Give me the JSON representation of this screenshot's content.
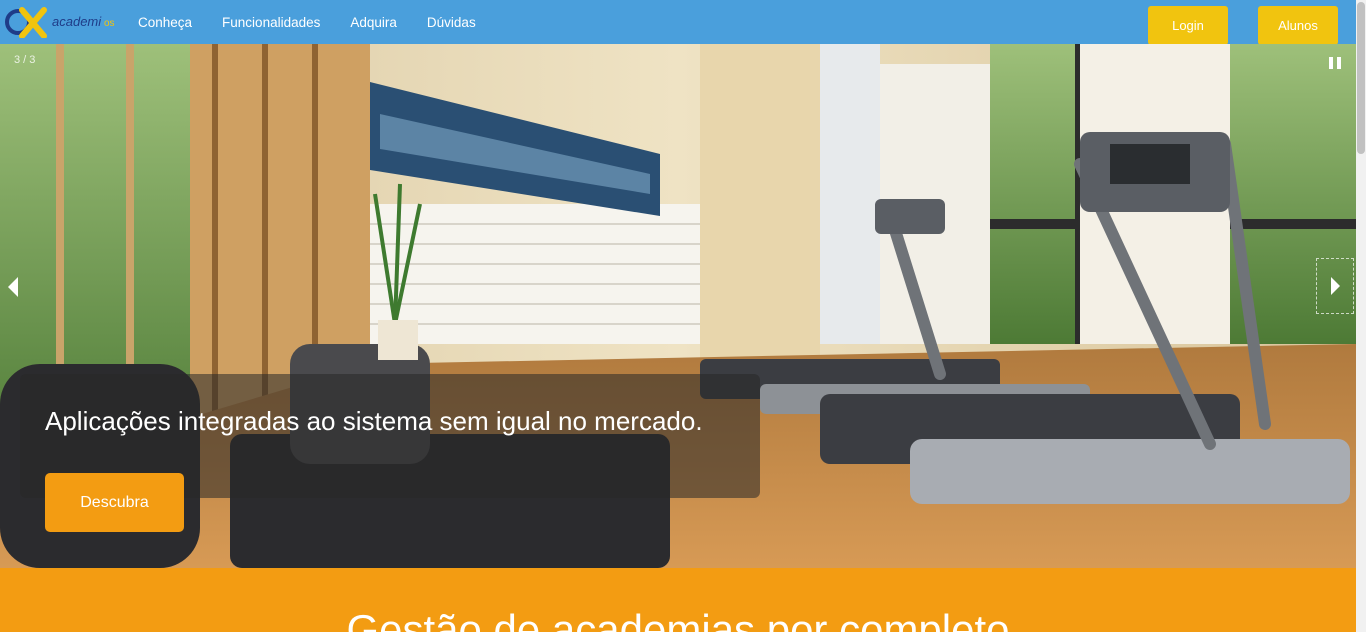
{
  "brand": {
    "logo_text": "academi",
    "logo_suffix": "os"
  },
  "nav": {
    "items": [
      "Conheça",
      "Funcionalidades",
      "Adquira",
      "Dúvidas"
    ]
  },
  "header_buttons": {
    "login": "Login",
    "alunos": "Alunos"
  },
  "hero": {
    "slide_counter": "3 / 3",
    "caption": "Aplicações integradas ao sistema sem igual no mercado.",
    "cta": "Descubra"
  },
  "section": {
    "title": "Gestão de academias por completo"
  },
  "colors": {
    "navbar": "#4a9fdc",
    "accent_yellow": "#f1c40f",
    "accent_orange": "#f39c12"
  }
}
